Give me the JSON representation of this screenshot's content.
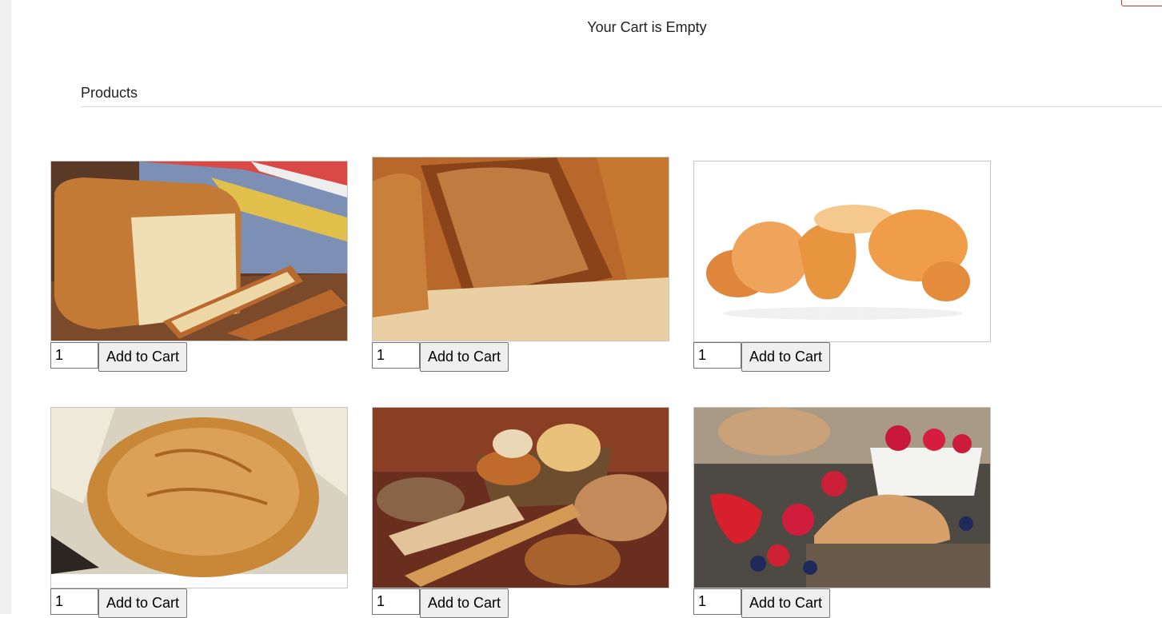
{
  "cart": {
    "status": "Your Cart is Empty"
  },
  "products_section": {
    "heading": "Products"
  },
  "products": [
    {
      "image": "sliced-bread-loaf-image",
      "quantity": "1",
      "add_label": "Add to Cart"
    },
    {
      "image": "crusty-bread-closeup-image",
      "quantity": "1",
      "add_label": "Add to Cart"
    },
    {
      "image": "bread-rolls-image",
      "quantity": "1",
      "add_label": "Add to Cart"
    },
    {
      "image": "round-country-loaf-image",
      "quantity": "1",
      "add_label": "Add to Cart"
    },
    {
      "image": "bread-basket-assortment-image",
      "quantity": "1",
      "add_label": "Add to Cart"
    },
    {
      "image": "croissant-berries-image",
      "quantity": "1",
      "add_label": "Add to Cart"
    }
  ],
  "colors": {
    "crust": "#c9772c",
    "crumb": "#f1dcb0",
    "accent": "#c0392b"
  }
}
